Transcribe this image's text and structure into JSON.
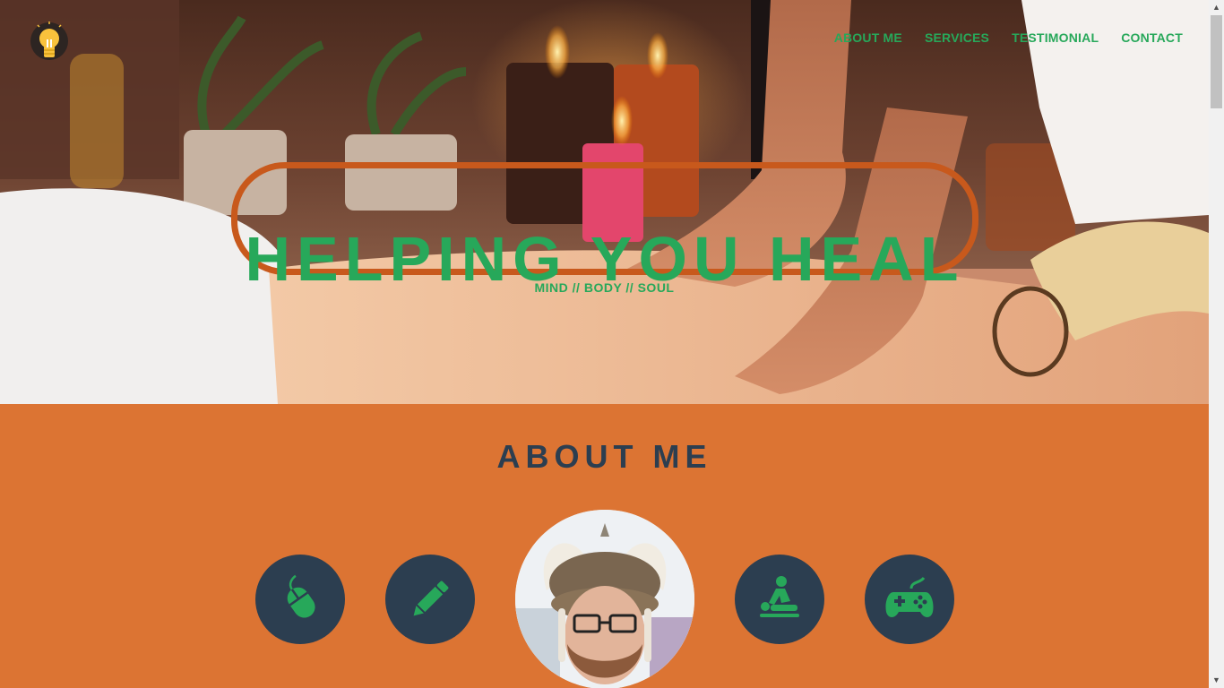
{
  "nav": {
    "items": [
      {
        "label": "ABOUT ME"
      },
      {
        "label": "SERVICES"
      },
      {
        "label": "TESTIMONIAL"
      },
      {
        "label": "CONTACT"
      }
    ]
  },
  "hero": {
    "headline": "HELPING YOU HEAL",
    "tagline": "MIND // BODY // SOUL"
  },
  "about": {
    "title": "ABOUT ME",
    "icons": [
      "computer-mouse-icon",
      "pencil-icon",
      "massage-icon",
      "gamepad-icon"
    ]
  },
  "colors": {
    "accent_green": "#27a85a",
    "section_orange": "#dc7433",
    "navy": "#2c3e50",
    "ring_orange": "#c8591c"
  }
}
